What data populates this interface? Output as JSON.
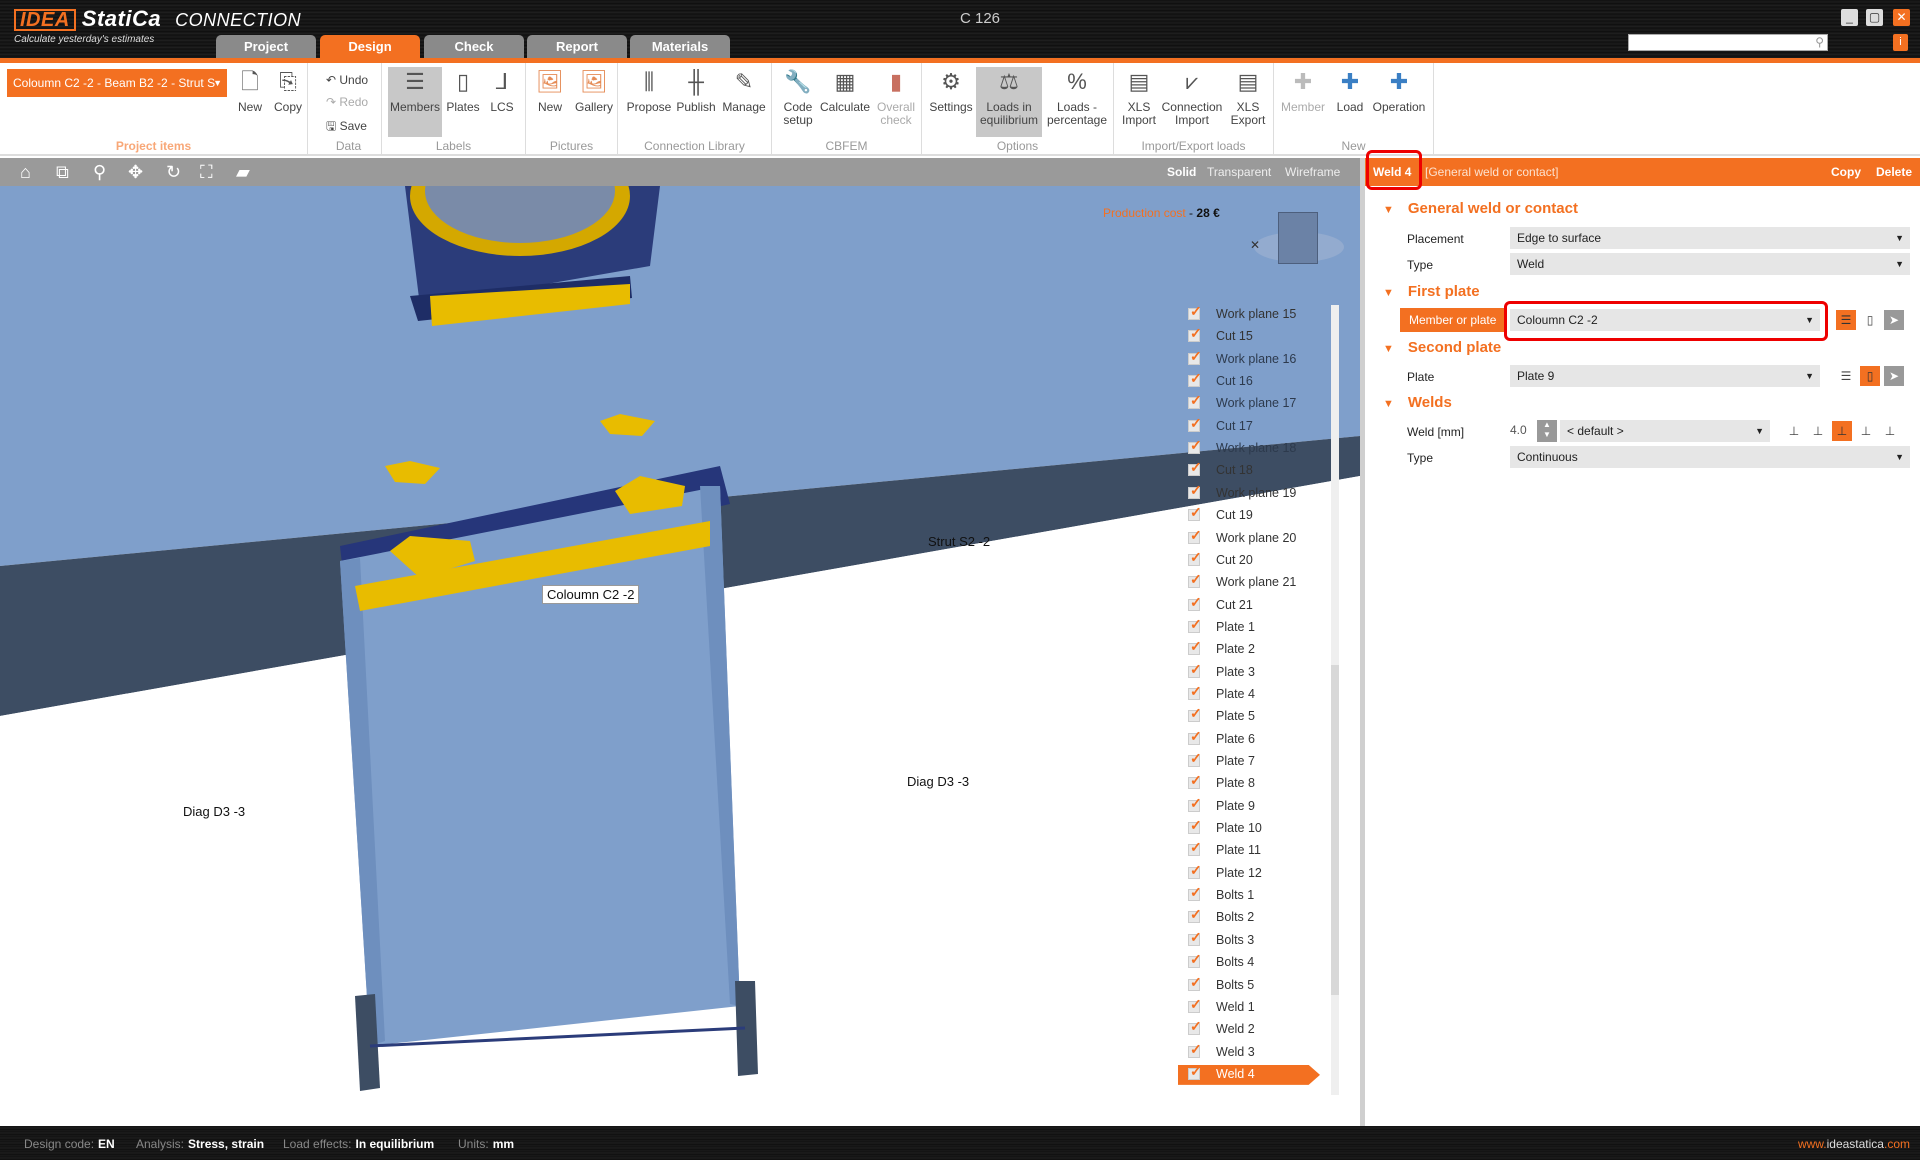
{
  "app": {
    "brand": "IDEA",
    "brand2": "StatiCa",
    "product": "CONNECTION",
    "tagline": "Calculate yesterday's estimates",
    "window_title": "C 126",
    "search_placeholder": ""
  },
  "tabs": [
    {
      "label": "Project"
    },
    {
      "label": "Design"
    },
    {
      "label": "Check"
    },
    {
      "label": "Report"
    },
    {
      "label": "Materials"
    }
  ],
  "ribbon": {
    "project_selector": "Coloumn C2 -2 - Beam B2 -2 - Strut S",
    "project_items": {
      "label": "Project items",
      "new": "New",
      "copy": "Copy"
    },
    "data": {
      "label": "Data",
      "undo": "Undo",
      "redo": "Redo",
      "save": "Save"
    },
    "labels": {
      "label": "Labels",
      "members": "Members",
      "plates": "Plates",
      "lcs": "LCS"
    },
    "pictures": {
      "label": "Pictures",
      "new": "New",
      "gallery": "Gallery"
    },
    "library": {
      "label": "Connection Library",
      "propose": "Propose",
      "publish": "Publish",
      "manage": "Manage"
    },
    "cbfem": {
      "label": "CBFEM",
      "code_setup_1": "Code",
      "code_setup_2": "setup",
      "calculate": "Calculate",
      "overall_1": "Overall",
      "overall_2": "check"
    },
    "options": {
      "label": "Options",
      "settings": "Settings",
      "loads_eq_1": "Loads in",
      "loads_eq_2": "equilibrium",
      "loads_pct_1": "Loads -",
      "loads_pct_2": "percentage"
    },
    "importexport": {
      "label": "Import/Export loads",
      "xls_import_1": "XLS",
      "xls_import_2": "Import",
      "conn_import_1": "Connection",
      "conn_import_2": "Import",
      "xls_export_1": "XLS",
      "xls_export_2": "Export"
    },
    "newgrp": {
      "label": "New",
      "member": "Member",
      "load": "Load",
      "operation": "Operation"
    }
  },
  "viewport": {
    "view_modes": [
      "Solid",
      "Transparent",
      "Wireframe"
    ],
    "production_cost_label": "Production cost",
    "production_cost_value": "28 €",
    "labels": {
      "coloumn": "Coloumn C2 -2",
      "strut": "Strut S2 -2",
      "diag_left": "Diag D3 -3",
      "diag_right": "Diag D3 -3"
    },
    "tree": [
      "Work plane 15",
      "Cut 15",
      "Work plane 16",
      "Cut 16",
      "Work plane 17",
      "Cut 17",
      "Work plane 18",
      "Cut 18",
      "Work plane 19",
      "Cut 19",
      "Work plane 20",
      "Cut 20",
      "Work plane 21",
      "Cut 21",
      "Plate 1",
      "Plate 2",
      "Plate 3",
      "Plate 4",
      "Plate 5",
      "Plate 6",
      "Plate 7",
      "Plate 8",
      "Plate 9",
      "Plate 10",
      "Plate 11",
      "Plate 12",
      "Bolts 1",
      "Bolts 2",
      "Bolts 3",
      "Bolts 4",
      "Bolts 5",
      "Weld 1",
      "Weld 2",
      "Weld 3",
      "Weld 4"
    ],
    "tree_selected": "Weld 4"
  },
  "panel": {
    "title": "Weld 4",
    "subtitle": "[General weld or contact]",
    "copy": "Copy",
    "delete": "Delete",
    "sections": {
      "general": "General weld or contact",
      "first": "First plate",
      "second": "Second plate",
      "welds": "Welds"
    },
    "placement_label": "Placement",
    "placement_value": "Edge to surface",
    "type_label": "Type",
    "type_value": "Weld",
    "member_label": "Member or plate",
    "member_value": "Coloumn C2 -2",
    "plate_label": "Plate",
    "plate_value": "Plate 9",
    "weld_label": "Weld [mm]",
    "weld_size": "4.0",
    "weld_value": "< default >",
    "weld_type_label": "Type",
    "weld_type_value": "Continuous"
  },
  "status": {
    "design_code_k": "Design code:",
    "design_code_v": "EN",
    "analysis_k": "Analysis:",
    "analysis_v": "Stress, strain",
    "load_k": "Load effects:",
    "load_v": "In equilibrium",
    "units_k": "Units:",
    "units_v": "mm",
    "url_a": "www.",
    "url_b": "ideastatica",
    "url_c": ".com"
  },
  "colors": {
    "accent": "#f37021",
    "steel": "#7f9fcb",
    "dark_steel": "#3d4d63",
    "bolt": "#f0c000",
    "highlight": "#e00000"
  }
}
